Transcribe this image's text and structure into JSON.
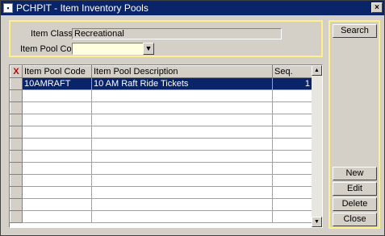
{
  "window": {
    "title": "PCHPIT - Item Inventory Pools",
    "close_glyph": "×"
  },
  "filter": {
    "item_class_label": "Item Class",
    "item_class_value": "Recreational",
    "item_pool_code_label": "Item Pool Code",
    "item_pool_code_value": ""
  },
  "grid": {
    "headers": {
      "x": "X",
      "code": "Item Pool Code",
      "desc": "Item Pool Description",
      "seq": "Seq."
    },
    "rows": [
      {
        "code": "10AMRAFT",
        "desc": "10 AM Raft Ride Tickets",
        "seq": "1",
        "selected": true
      }
    ],
    "empty_row_count": 11
  },
  "buttons": {
    "search": "Search",
    "new": "New",
    "edit": "Edit",
    "delete": "Delete",
    "close": "Close"
  },
  "colors": {
    "selection": "#0a246a",
    "highlight_border": "#fff08a",
    "editable_field": "#ffffe0"
  }
}
